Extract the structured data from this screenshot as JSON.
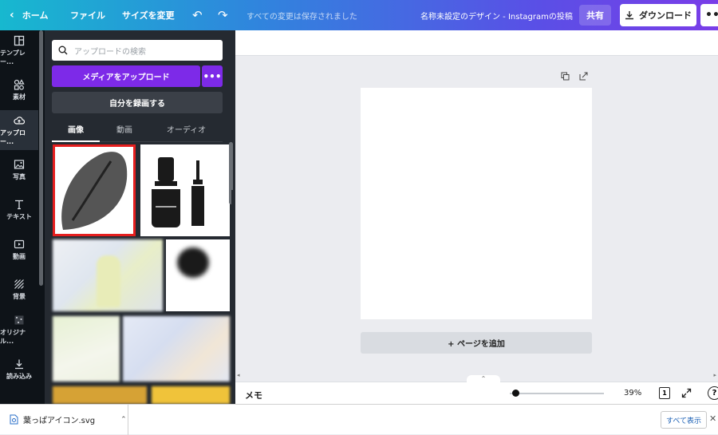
{
  "topbar": {
    "home": "ホーム",
    "file": "ファイル",
    "resize": "サイズを変更",
    "saved_status": "すべての変更は保存されました",
    "design_title": "名称未設定のデザイン - Instagramの投稿",
    "share": "共有",
    "download": "ダウンロード",
    "more": "•••"
  },
  "rail": {
    "items": [
      {
        "label": "テンプレー...",
        "icon": "template-icon"
      },
      {
        "label": "素材",
        "icon": "elements-icon"
      },
      {
        "label": "アップロー...",
        "icon": "upload-cloud-icon",
        "active": true
      },
      {
        "label": "写真",
        "icon": "photo-icon"
      },
      {
        "label": "テキスト",
        "icon": "text-icon"
      },
      {
        "label": "動画",
        "icon": "video-icon"
      },
      {
        "label": "背景",
        "icon": "background-icon"
      },
      {
        "label": "オリジナル...",
        "icon": "original-icon"
      },
      {
        "label": "読み込み",
        "icon": "import-icon"
      }
    ]
  },
  "panel": {
    "search_placeholder": "アップロードの検索",
    "upload_button": "メディアをアップロード",
    "upload_more": "•••",
    "record_button": "自分を録画する",
    "tabs": [
      "画像",
      "動画",
      "オーディオ"
    ],
    "active_tab": "画像"
  },
  "canvas": {
    "add_page": "+ ページを追加"
  },
  "bottombar": {
    "memo": "メモ",
    "zoom": "39%",
    "zoom_level": 0.39,
    "page_count": "1",
    "help": "?"
  },
  "download_bar": {
    "filename": "葉っぱアイコン.svg",
    "show_all": "すべて表示"
  },
  "colors": {
    "accent_purple": "#7d2ae8",
    "selection_red": "#e61e1e",
    "panel_bg": "#252a31",
    "rail_bg": "#0e1318"
  }
}
